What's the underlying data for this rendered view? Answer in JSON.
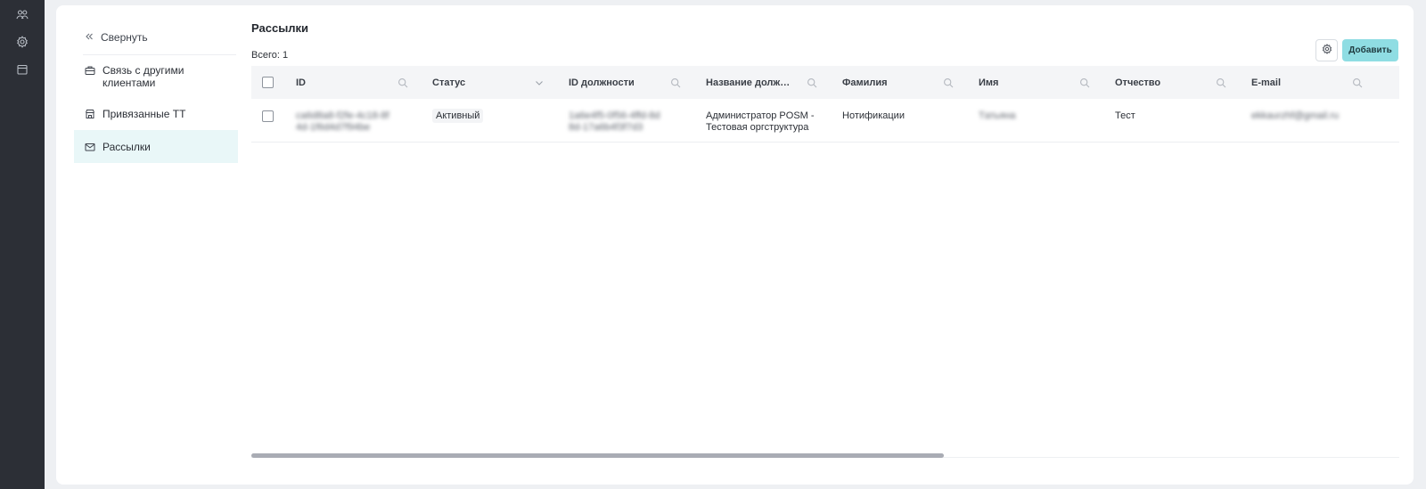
{
  "rail": {
    "icons": [
      "users-icon",
      "gear-icon",
      "calendar-icon"
    ]
  },
  "sidebar": {
    "collapse_label": "Свернуть",
    "items": [
      {
        "label": "Связь с другими клиентами",
        "icon": "briefcase-icon",
        "active": false
      },
      {
        "label": "Привязанные ТТ",
        "icon": "store-icon",
        "active": false
      },
      {
        "label": "Рассылки",
        "icon": "envelope-icon",
        "active": true
      }
    ]
  },
  "main": {
    "title": "Рассылки",
    "total_label": "Всего: 1",
    "add_label": "Добавить"
  },
  "table": {
    "columns": [
      {
        "label": "ID",
        "icon": "search-icon"
      },
      {
        "label": "Статус",
        "icon": "chevron-down-icon"
      },
      {
        "label": "ID должности",
        "icon": "search-icon"
      },
      {
        "label": "Название должн...",
        "icon": "search-icon"
      },
      {
        "label": "Фамилия",
        "icon": "search-icon"
      },
      {
        "label": "Имя",
        "icon": "search-icon"
      },
      {
        "label": "Отчество",
        "icon": "search-icon"
      },
      {
        "label": "E-mail",
        "icon": "search-icon"
      }
    ],
    "rows": [
      {
        "id": "ca6d8a8-f2fe-4c18-8f4d-1f6d4d7f94be",
        "status": "Активный",
        "position_id": "1a6e4f5-0f56-4ffd-8d8d-17a6b4f3f7d3",
        "position_name": "Администратор POSM - Тестовая оргструктура",
        "last_name": "Нотификации",
        "first_name": "Tатьяна",
        "patronymic": "Тест",
        "email": "ekkaurzhf@gmail.ru"
      }
    ]
  },
  "colors": {
    "rail_bg": "#2c2f36",
    "accent_button": "#8fdde3",
    "active_item_bg": "#e9f7f8"
  }
}
